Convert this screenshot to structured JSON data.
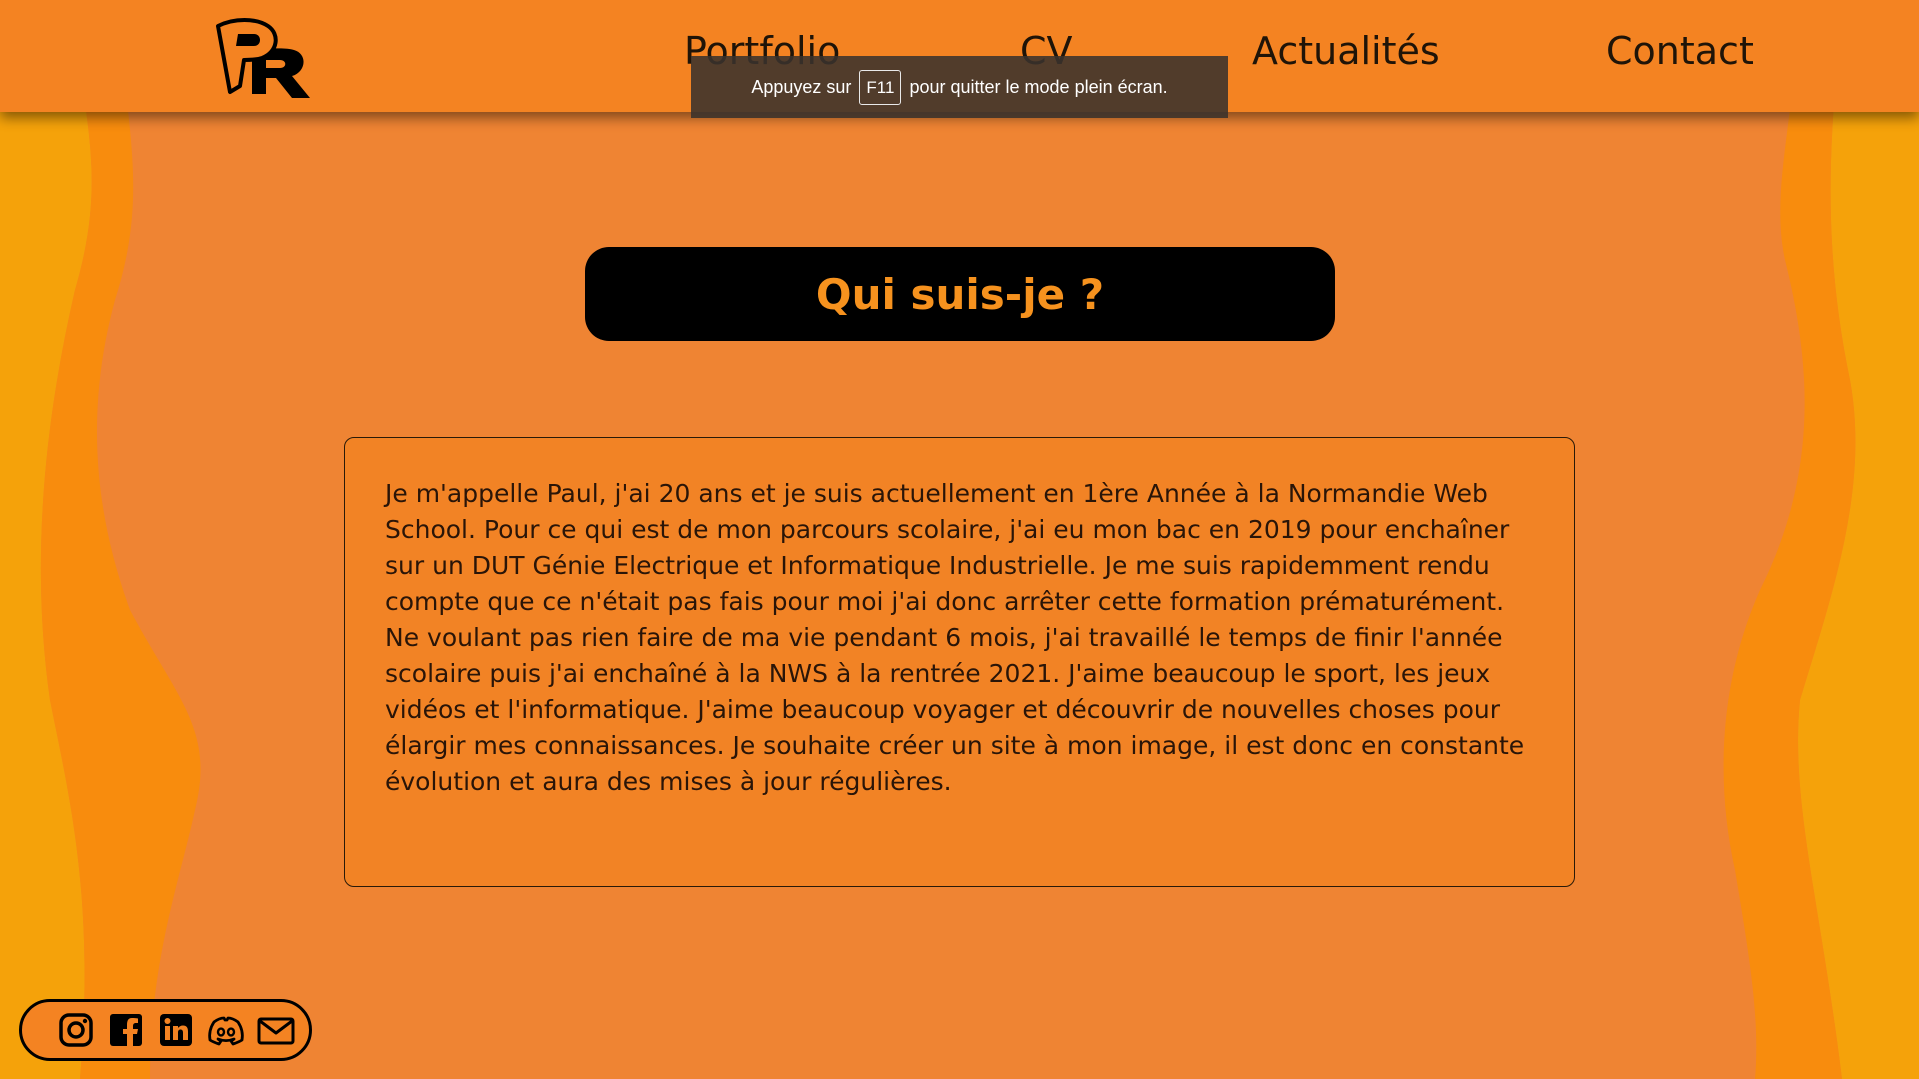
{
  "page": {
    "background": "#EF8433",
    "accent": "#F6921E",
    "header_bg": "#F48322"
  },
  "header": {
    "logo": {
      "letters": "PR",
      "icon": "logo"
    },
    "nav": [
      {
        "label": "Portfolio"
      },
      {
        "label": "CV"
      },
      {
        "label": "Actualités"
      },
      {
        "label": "Contact"
      }
    ]
  },
  "fullscreen_notice": {
    "prefix": "Appuyez sur",
    "key": "F11",
    "suffix": "pour quitter le mode plein écran."
  },
  "main": {
    "title": "Qui suis-je ?",
    "about": "Je m'appelle Paul, j'ai 20 ans et je suis actuellement en 1ère Année à la Normandie Web School. Pour ce qui est de mon parcours scolaire, j'ai eu mon bac en 2019 pour enchaîner sur un DUT Génie Electrique et Informatique Industrielle. Je me suis rapidemment rendu compte que ce n'était pas fais pour moi j'ai donc arrêter cette formation prématurément. Ne voulant pas rien faire de ma vie pendant 6 mois, j'ai travaillé le temps de finir l'année scolaire puis j'ai enchaîné à la NWS à la rentrée 2021. J'aime beaucoup le sport, les jeux vidéos et l'informatique. J'aime beaucoup voyager et découvrir de nouvelles choses pour élargir mes connaissances. Je souhaite créer un site à mon image, il est donc en constante évolution et aura des mises à jour régulières."
  },
  "social": [
    {
      "icon": "instagram-icon"
    },
    {
      "icon": "facebook-icon"
    },
    {
      "icon": "linkedin-icon"
    },
    {
      "icon": "discord-icon"
    },
    {
      "icon": "mail-icon"
    }
  ]
}
